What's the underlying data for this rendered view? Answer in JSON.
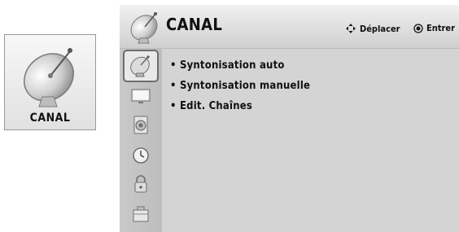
{
  "tile": {
    "icon": "satellite-dish-icon",
    "label": "CANAL"
  },
  "header": {
    "icon": "satellite-dish-icon",
    "title": "CANAL",
    "hint_move_icon": "four-way-arrows-icon",
    "hint_move": "Déplacer",
    "hint_enter_icon": "ok-dot-icon",
    "hint_enter": "Entrer"
  },
  "sidebar": {
    "items": [
      {
        "icon": "satellite-dish-icon",
        "selected": true
      },
      {
        "icon": "monitor-icon",
        "selected": false
      },
      {
        "icon": "speaker-icon",
        "selected": false
      },
      {
        "icon": "clock-icon",
        "selected": false
      },
      {
        "icon": "lock-icon",
        "selected": false
      },
      {
        "icon": "toolbox-icon",
        "selected": false
      }
    ]
  },
  "menu": {
    "items": [
      {
        "label": "• Syntonisation auto"
      },
      {
        "label": "• Syntonisation manuelle"
      },
      {
        "label": "• Edit. Chaînes"
      }
    ]
  }
}
